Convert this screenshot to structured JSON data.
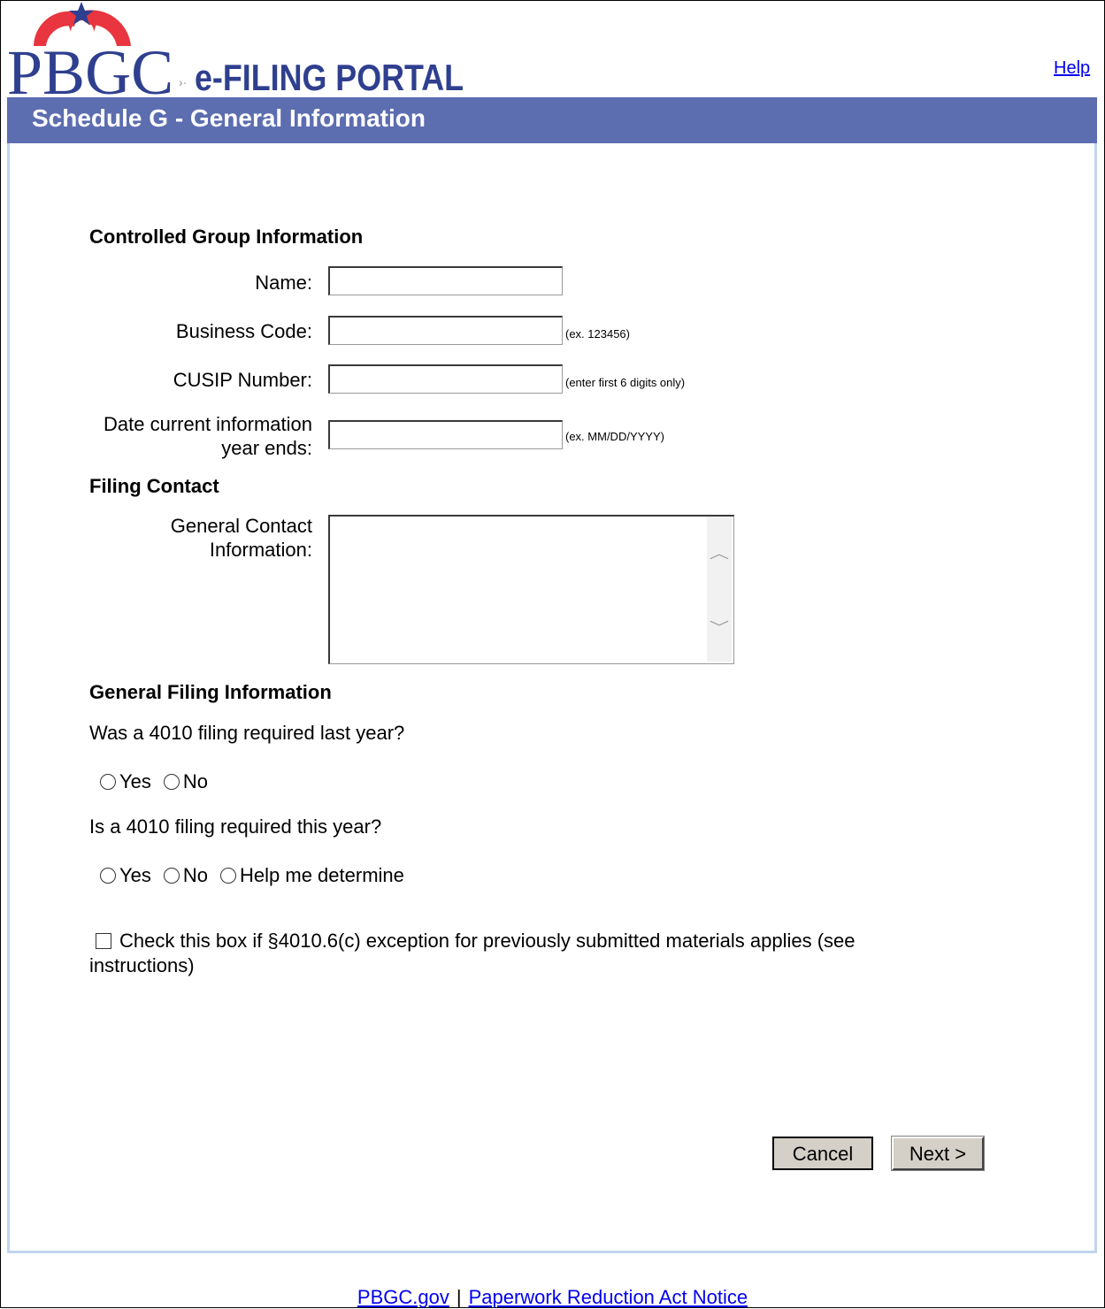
{
  "header": {
    "logo_letters": "PBGC",
    "logo_subtitle": "e-FILING PORTAL",
    "help_link": "Help"
  },
  "page_title": "Schedule G - General Information",
  "controlled_group": {
    "section_title": "Controlled Group Information",
    "name_label": "Name:",
    "name_value": "",
    "business_code_label": "Business Code:",
    "business_code_value": "",
    "business_code_hint": "(ex. 123456)",
    "cusip_label": "CUSIP Number:",
    "cusip_value": "",
    "cusip_hint": "(enter first 6 digits only)",
    "date_label_line1": "Date current information",
    "date_label_line2": "year ends:",
    "date_value": "",
    "date_hint": "(ex.  MM/DD/YYYY)"
  },
  "filing_contact": {
    "section_title": "Filing Contact",
    "general_contact_label_line1": "General Contact",
    "general_contact_label_line2": "Information:",
    "general_contact_value": ""
  },
  "general_filing": {
    "section_title": "General Filing Information",
    "q1": "Was a 4010 filing required last year?",
    "q1_options": [
      "Yes",
      "No"
    ],
    "q2": "Is a 4010 filing required this year?",
    "q2_options": [
      "Yes",
      "No",
      "Help me determine"
    ],
    "exception_checkbox_label": "Check this box if §4010.6(c) exception for previously submitted materials applies (see instructions)",
    "exception_checked": false
  },
  "buttons": {
    "cancel": "Cancel",
    "next": "Next >"
  },
  "footer": {
    "link1": "PBGC.gov",
    "separator": "|",
    "link2": "Paperwork Reduction Act Notice"
  },
  "colors": {
    "title_bar": "#5c6db0",
    "content_border": "#c1d5ee",
    "logo_red": "#e8353f",
    "logo_blue": "#2f3f8f",
    "link": "#0000ee"
  }
}
